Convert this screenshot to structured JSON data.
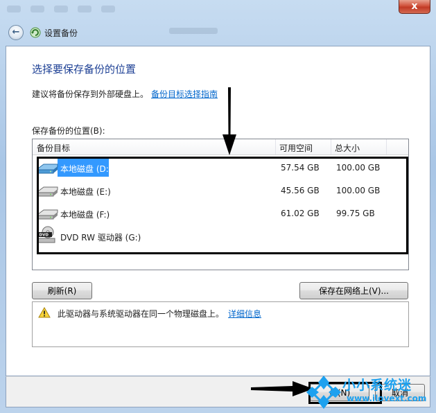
{
  "window": {
    "close_label": "x"
  },
  "nav": {
    "back_label": "←",
    "title": "设置备份"
  },
  "main": {
    "heading": "选择要保存备份的位置",
    "advice_text": "建议将备份保存到外部硬盘上。",
    "advice_link": "备份目标选择指南",
    "list_label": "保存备份的位置(B):",
    "columns": [
      "备份目标",
      "可用空间",
      "总大小"
    ],
    "drives": [
      {
        "name": "本地磁盘 (D:)",
        "free": "57.54 GB",
        "total": "100.00 GB",
        "icon": "hard-drive-icon",
        "selected": true
      },
      {
        "name": "本地磁盘 (E:)",
        "free": "45.56 GB",
        "total": "100.00 GB",
        "icon": "hard-drive-icon",
        "selected": false
      },
      {
        "name": "本地磁盘 (F:)",
        "free": "61.02 GB",
        "total": "99.75 GB",
        "icon": "hard-drive-icon",
        "selected": false
      },
      {
        "name": "DVD RW 驱动器 (G:)",
        "free": "",
        "total": "",
        "icon": "dvd-drive-icon",
        "selected": false
      }
    ],
    "refresh_label": "刷新(R)",
    "network_label": "保存在网络上(V)...",
    "warning_text": "此驱动器与系统驱动器在同一个物理磁盘上。",
    "warning_link": "详细信息"
  },
  "footer": {
    "next_label": "步(N)",
    "cancel_label": "取消"
  },
  "watermark": {
    "title": "小小系统迷",
    "url": "www.ilovext.com"
  },
  "colors": {
    "selection": "#3399ff",
    "heading": "#1c3f94",
    "link": "#0066cc",
    "watermark": "#1da1ef"
  }
}
